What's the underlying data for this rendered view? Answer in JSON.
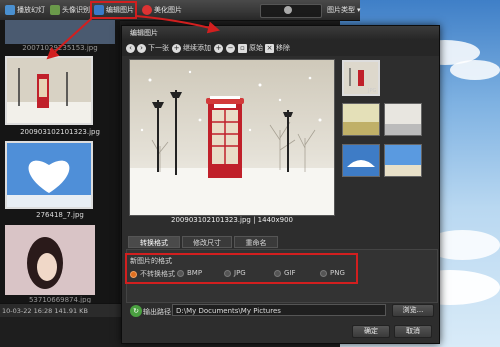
{
  "toolbar": {
    "slideshow_label": "播放幻灯",
    "avatar_label": "头像识别",
    "edit_label": "编辑图片",
    "beautify_label": "美化图片",
    "type_label": "图片类型"
  },
  "thumbnails": {
    "top_filename": "20071029235153.jpg",
    "items": [
      {
        "label": "200903102101323.jpg"
      },
      {
        "label": "276418_7.jpg"
      },
      {
        "label": "53710669874.jpg"
      }
    ]
  },
  "statusbar": {
    "text": "10-03-22 16:28   141.91 KB"
  },
  "dialog": {
    "title": "编辑图片",
    "tools": {
      "next": "下一张",
      "add": "继续添加",
      "zoom_in": "",
      "zoom_out": "",
      "original": "原始",
      "remove": "移除"
    },
    "preview_caption": "200903102101323.jpg | 1440x900",
    "side_thumb_tag": "JPG",
    "tabs": [
      "转换格式",
      "修改尺寸",
      "重命名"
    ],
    "format_heading": "新图片的格式",
    "formats": [
      "不转换格式",
      "BMP",
      "JPG",
      "GIF",
      "PNG"
    ],
    "output_label": "输出路径",
    "output_path": "D:\\My Documents\\My Pictures",
    "browse_label": "浏览...",
    "ok_label": "确定",
    "cancel_label": "取消"
  },
  "colors": {
    "highlight": "#d21f1f",
    "dialog_bg": "#2d2d2d",
    "phonebooth": "#c0202a"
  }
}
